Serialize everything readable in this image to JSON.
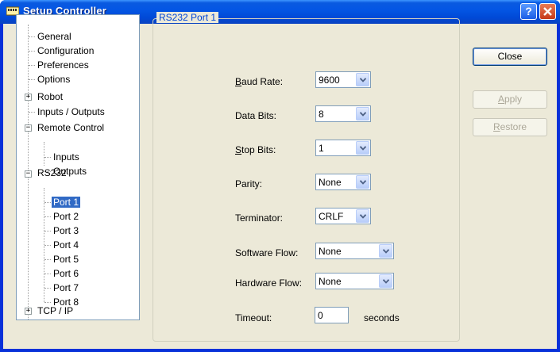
{
  "window": {
    "title": "Setup Controller",
    "icon": "controller-icon",
    "help": "?"
  },
  "tree": {
    "general": "General",
    "configuration": "Configuration",
    "preferences": "Preferences",
    "options": "Options",
    "robot": "Robot",
    "io": "Inputs / Outputs",
    "remote": "Remote Control",
    "remote_inputs": "Inputs",
    "remote_outputs": "Outputs",
    "rs232": "RS232",
    "port1": "Port 1",
    "port2": "Port 2",
    "port3": "Port 3",
    "port4": "Port 4",
    "port5": "Port 5",
    "port6": "Port 6",
    "port7": "Port 7",
    "port8": "Port 8",
    "tcpip": "TCP / IP",
    "expand_plus": "+",
    "expand_minus": "−"
  },
  "group": {
    "title": "RS232 Port 1"
  },
  "fields": {
    "baud": {
      "label_accel": "B",
      "label_rest": "aud Rate:",
      "value": "9600"
    },
    "data_bits": {
      "label": "Data Bits:",
      "value": "8"
    },
    "stop": {
      "label_accel": "S",
      "label_rest": "top Bits:",
      "value": "1"
    },
    "parity": {
      "label": "Parity:",
      "value": "None"
    },
    "terminator": {
      "label": "Terminator:",
      "value": "CRLF"
    },
    "sw_flow": {
      "label": "Software Flow:",
      "value": "None"
    },
    "hw_flow": {
      "label": "Hardware Flow:",
      "value": "None"
    },
    "timeout": {
      "label": "Timeout:",
      "value": "0",
      "unit": "seconds"
    }
  },
  "buttons": {
    "close": "Close",
    "apply_accel": "A",
    "apply_rest": "pply",
    "restore_accel": "R",
    "restore_rest": "estore"
  }
}
